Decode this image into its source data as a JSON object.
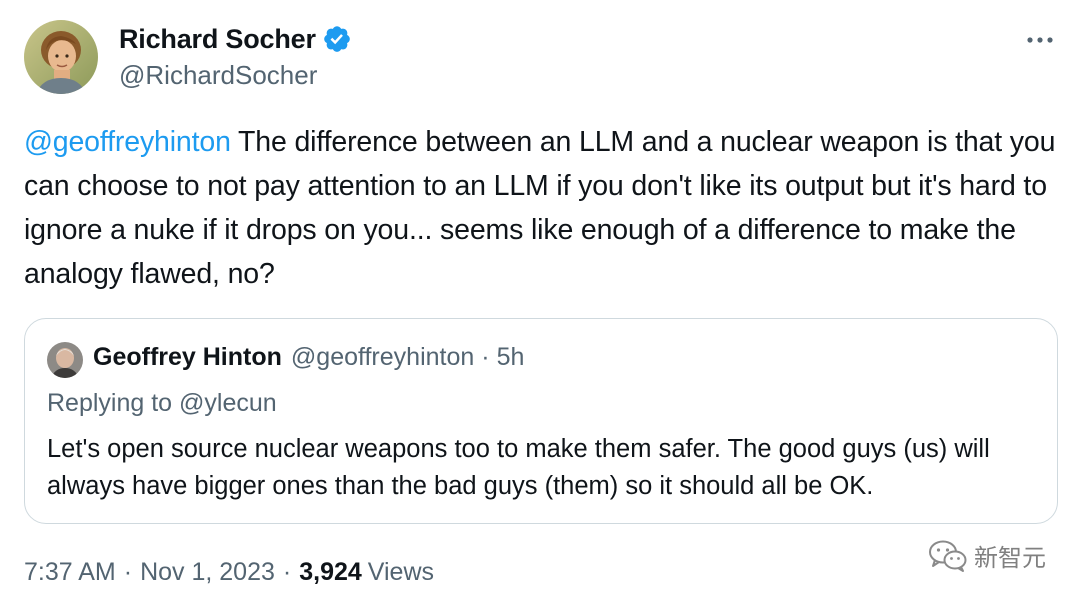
{
  "author": {
    "display_name": "Richard Socher",
    "handle": "@RichardSocher",
    "verified": true
  },
  "tweet": {
    "mention": "@geoffreyhinton",
    "text": " The difference between an LLM and a nuclear weapon is that you can choose to not pay attention to an LLM if you don't like its output but it's hard to ignore a nuke if it drops on you... seems like enough of a difference to make the analogy flawed, no?"
  },
  "quoted_tweet": {
    "display_name": "Geoffrey Hinton",
    "handle": "@geoffreyhinton",
    "separator": "·",
    "time": "5h",
    "replying_to": "Replying to @ylecun",
    "text": "Let's open source nuclear weapons too to make them safer. The good guys (us) will always have bigger ones than the bad guys (them) so it should all be OK."
  },
  "meta": {
    "time": "7:37 AM",
    "separator": "·",
    "date": "Nov 1, 2023",
    "views_count": "3,924",
    "views_label": "Views"
  },
  "watermark": {
    "text": "新智元"
  },
  "icons": {
    "verified": "verified-badge-icon",
    "more": "more-options-icon",
    "watermark": "wechat-icon"
  },
  "colors": {
    "accent": "#1d9bf0",
    "secondary_text": "#536471",
    "primary_text": "#0f1419",
    "border": "#cfd9de"
  }
}
